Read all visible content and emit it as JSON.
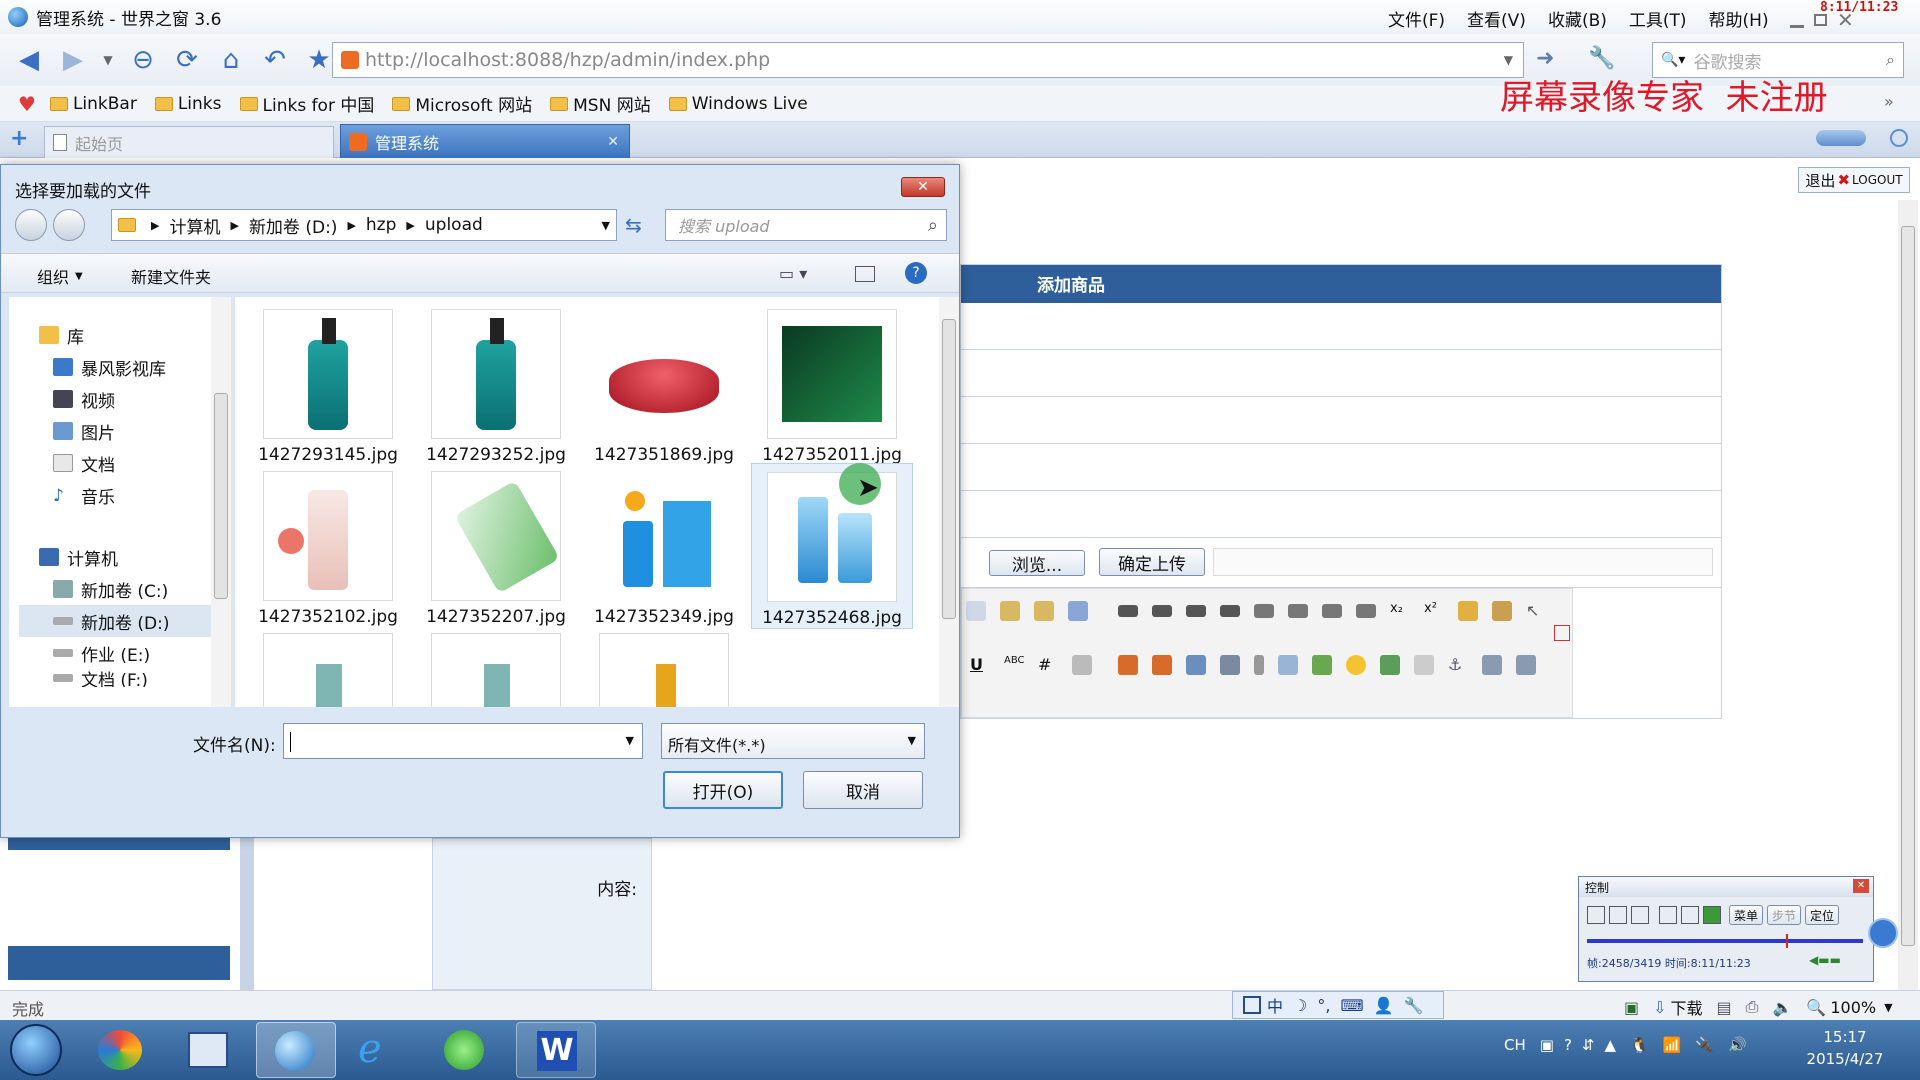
{
  "browser": {
    "title": "管理系统 - 世界之窗 3.6",
    "menu": [
      "文件(F)",
      "查看(V)",
      "收藏(B)",
      "工具(T)",
      "帮助(H)"
    ],
    "clock_overlay": "8:11/11:23",
    "url": "http://localhost:8088/hzp/admin/index.php",
    "search_placeholder": "谷歌搜索",
    "bookmarks": [
      "LinkBar",
      "Links",
      "Links for 中国",
      "Microsoft 网站",
      "MSN 网站",
      "Windows Live"
    ],
    "watermark": "屏幕录像专家  未注册",
    "tabs": [
      "起始页",
      "管理系统"
    ],
    "status_left": "完成",
    "status_download": "下载",
    "zoom": "100%"
  },
  "page": {
    "logout_label": "退出",
    "logout_en": "LOGOUT",
    "panel_title": "添加商品",
    "browse_label": "浏览...",
    "upload_label": "确定上传",
    "content_label": "内容:"
  },
  "dialog": {
    "title": "选择要加载的文件",
    "breadcrumb": [
      "计算机",
      "新加卷 (D:)",
      "hzp",
      "upload"
    ],
    "search_placeholder": "搜索 upload",
    "organize": "组织",
    "new_folder": "新建文件夹",
    "sidebar": {
      "library": "库",
      "library_items": [
        "暴风影视库",
        "视频",
        "图片",
        "文档",
        "音乐"
      ],
      "computer": "计算机",
      "drives": [
        "新加卷 (C:)",
        "新加卷 (D:)",
        "作业 (E:)",
        "文档 (F:)"
      ]
    },
    "files": [
      "1427293145.jpg",
      "1427293252.jpg",
      "1427351869.jpg",
      "1427352011.jpg",
      "1427352102.jpg",
      "1427352207.jpg",
      "1427352349.jpg",
      "1427352468.jpg"
    ],
    "filename_label": "文件名(N):",
    "filename_value": "",
    "filetype": "所有文件(*.*)",
    "open_label": "打开(O)",
    "cancel_label": "取消"
  },
  "control": {
    "title": "控制",
    "btn_menu": "菜单",
    "btn_step": "步节",
    "btn_locate": "定位",
    "info": "帧:2458/3419 时间:8:11/11:23",
    "progress": 0.72
  },
  "taskbar": {
    "lang": "CH",
    "time": "15:17",
    "date": "2015/4/27"
  },
  "ime": {
    "mode": "中"
  },
  "colors": {
    "accent": "#2f5f9a",
    "watermark": "#e0192a"
  }
}
